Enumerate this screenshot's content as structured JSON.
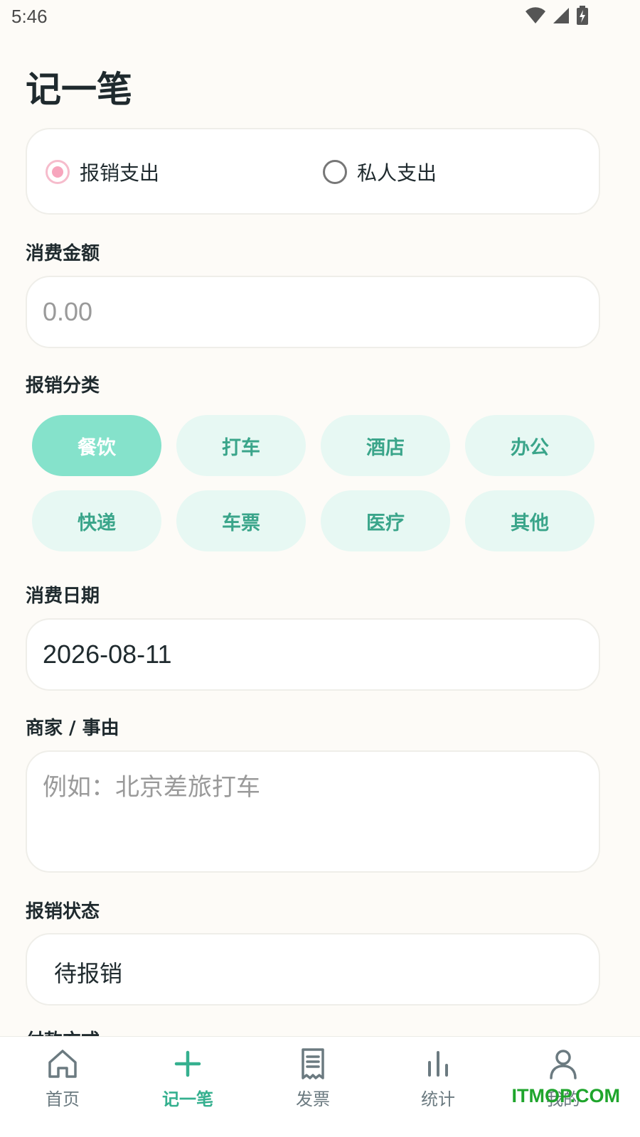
{
  "status_bar": {
    "time": "5:46",
    "icons": [
      "wifi-icon",
      "signal-icon",
      "battery-charging-icon"
    ]
  },
  "page": {
    "title": "记一笔"
  },
  "expense_type": {
    "options": [
      {
        "label": "报销支出",
        "checked": true
      },
      {
        "label": "私人支出",
        "checked": false
      }
    ]
  },
  "amount": {
    "label": "消费金额",
    "placeholder": "0.00",
    "value": ""
  },
  "category": {
    "label": "报销分类",
    "items": [
      {
        "label": "餐饮",
        "selected": true
      },
      {
        "label": "打车",
        "selected": false
      },
      {
        "label": "酒店",
        "selected": false
      },
      {
        "label": "办公",
        "selected": false
      },
      {
        "label": "快递",
        "selected": false
      },
      {
        "label": "车票",
        "selected": false
      },
      {
        "label": "医疗",
        "selected": false
      },
      {
        "label": "其他",
        "selected": false
      }
    ]
  },
  "date": {
    "label": "消费日期",
    "value": "2026-08-11"
  },
  "merchant": {
    "label": "商家 / 事由",
    "placeholder": "例如：北京差旅打车"
  },
  "reimburse_status": {
    "label": "报销状态",
    "value": "待报销"
  },
  "payment_method": {
    "label": "付款方式"
  },
  "nav": {
    "items": [
      {
        "label": "首页",
        "icon": "home-icon",
        "active": false
      },
      {
        "label": "记一笔",
        "icon": "plus-icon",
        "active": true
      },
      {
        "label": "发票",
        "icon": "receipt-icon",
        "active": false
      },
      {
        "label": "统计",
        "icon": "bar-chart-icon",
        "active": false
      },
      {
        "label": "我的",
        "icon": "user-icon",
        "active": false
      }
    ]
  },
  "watermark": "ITMOP.COM",
  "colors": {
    "accent": "#35b08f",
    "chip_bg": "#e7f8f3",
    "chip_active_bg": "#85e2cb",
    "radio_checked": "#f7a5bd",
    "background": "#fdfbf7"
  }
}
